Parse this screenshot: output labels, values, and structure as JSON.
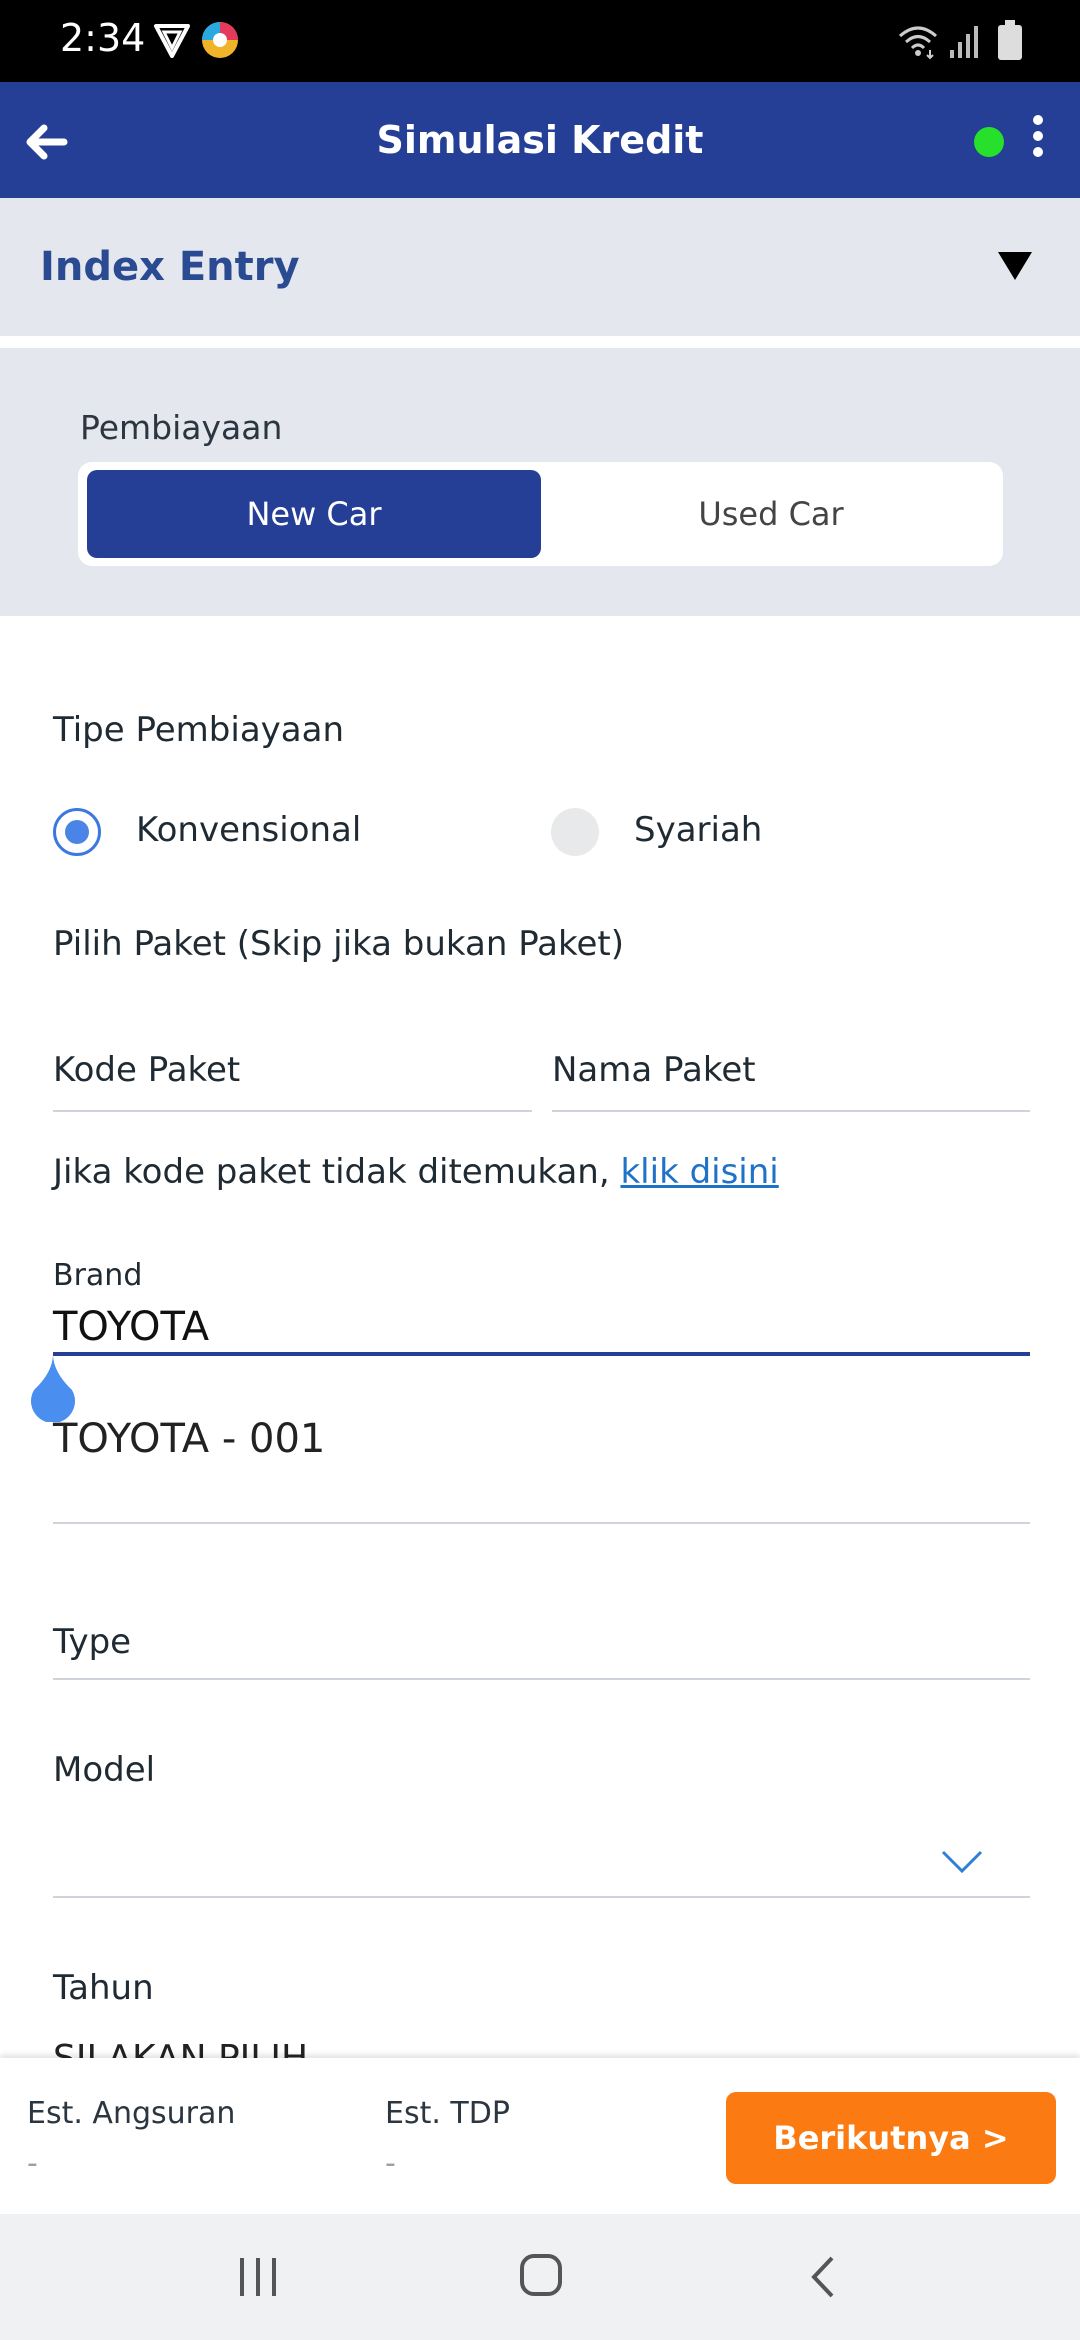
{
  "status_bar": {
    "time": "2:34",
    "icons": [
      "vpn-shield-icon",
      "app-notification-icon",
      "wifi-icon",
      "signal-icon",
      "battery-icon"
    ]
  },
  "app_bar": {
    "title": "Simulasi Kredit",
    "back_icon": "arrow-left-icon",
    "status_dot_color": "#27e02b",
    "menu_icon": "more-vertical-icon"
  },
  "index_entry": {
    "label": "Index Entry",
    "toggle_icon": "triangle-down-icon"
  },
  "pembiayaan": {
    "label": "Pembiayaan",
    "options": [
      "New Car",
      "Used Car"
    ],
    "selected": "New Car"
  },
  "form": {
    "tipe_label": "Tipe Pembiayaan",
    "radio_options": [
      "Konvensional",
      "Syariah"
    ],
    "radio_selected": "Konvensional",
    "paket_label": "Pilih Paket (Skip jika bukan Paket)",
    "kode_paket_placeholder": "Kode Paket",
    "nama_paket_placeholder": "Nama Paket",
    "notfound_text": "Jika kode paket tidak ditemukan, ",
    "notfound_link": "klik disini",
    "brand_label": "Brand",
    "brand_value": "TOYOTA",
    "brand_suggestion": "TOYOTA - 001",
    "type_label": "Type",
    "model_label": "Model",
    "tahun_label": "Tahun",
    "tahun_value": "SILAKAN PILIH"
  },
  "summary": {
    "angsuran_label": "Est. Angsuran",
    "angsuran_value": "-",
    "tdp_label": "Est. TDP",
    "tdp_value": "-",
    "next_button": "Berikutnya >"
  },
  "colors": {
    "primary": "#243f95",
    "accent": "#fb7a12",
    "link": "#1e73c8",
    "panel_bg": "#e4e8ee"
  }
}
